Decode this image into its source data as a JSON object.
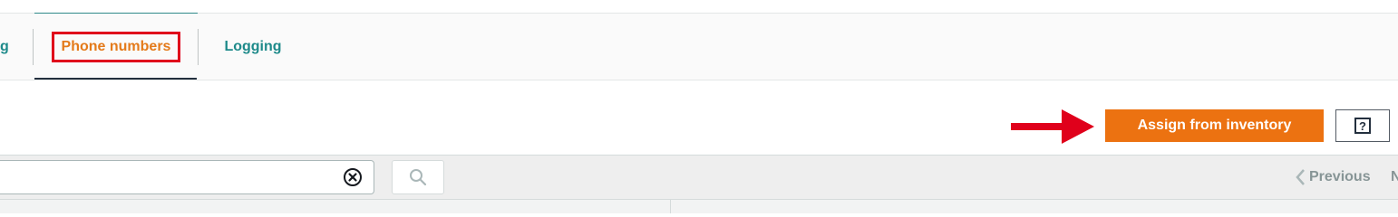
{
  "tabs": {
    "partial_label": "g",
    "phone_numbers_label": "Phone numbers",
    "logging_label": "Logging"
  },
  "toolbar": {
    "assign_label": "Assign from inventory",
    "help_label": "?"
  },
  "filter": {
    "search_value": "",
    "search_placeholder": ""
  },
  "pager": {
    "previous_label": "Previous",
    "next_label": "Next"
  },
  "colors": {
    "accent_orange": "#ec7211",
    "link_teal": "#1e8a8a",
    "annotation_red": "#e0001b"
  },
  "icons": {
    "clear": "clear-circle-x-icon",
    "search": "magnifier-icon",
    "help": "help-square-icon",
    "previous": "chevron-left-icon",
    "annotation": "red-arrow-icon"
  }
}
